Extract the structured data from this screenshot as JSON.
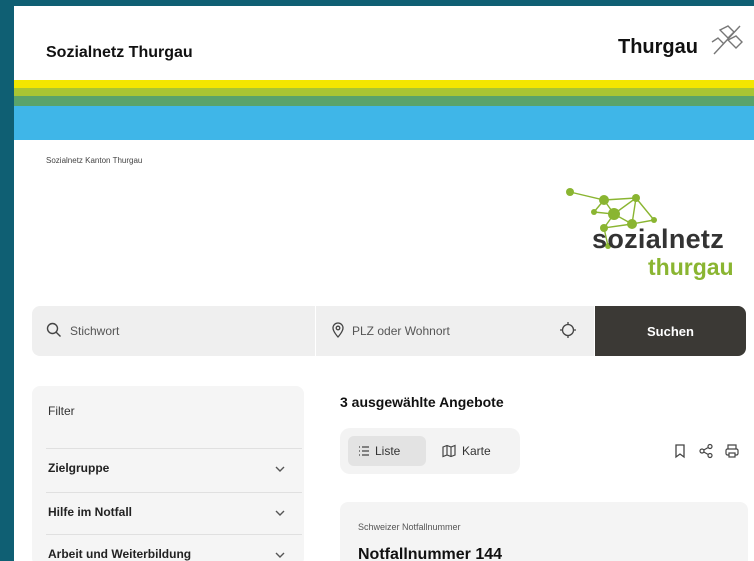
{
  "header": {
    "site_title": "Sozialnetz Thurgau",
    "brand": "Thurgau"
  },
  "breadcrumb": "Sozialnetz Kanton Thurgau",
  "logo": {
    "line1": "sozialnetz",
    "line2": "thurgau"
  },
  "search": {
    "keyword_placeholder": "Stichwort",
    "location_placeholder": "PLZ oder Wohnort",
    "button_label": "Suchen"
  },
  "filter": {
    "heading": "Filter",
    "items": [
      {
        "label": "Zielgruppe"
      },
      {
        "label": "Hilfe im Notfall"
      },
      {
        "label": "Arbeit und Weiterbildung"
      }
    ]
  },
  "results": {
    "title": "3 ausgewählte Angebote",
    "view_list_label": "Liste",
    "view_map_label": "Karte",
    "cards": [
      {
        "subtitle": "Schweizer Notfallnummer",
        "title": "Notfallnummer 144"
      }
    ]
  },
  "colors": {
    "stripe_yellow": "#f3e600",
    "stripe_lime": "#a9c533",
    "stripe_green": "#5aa36a",
    "stripe_blue": "#3fb6e8",
    "search_button": "#3b3935",
    "logo_green": "#8ab531",
    "frame_background": "#0f5f73"
  },
  "icons": {
    "search": "search-icon",
    "location": "location-pin-icon",
    "locate": "crosshair-icon",
    "chevron": "chevron-down-icon",
    "list": "list-icon",
    "map": "map-icon",
    "bookmark": "bookmark-icon",
    "share": "share-icon",
    "print": "print-icon"
  }
}
